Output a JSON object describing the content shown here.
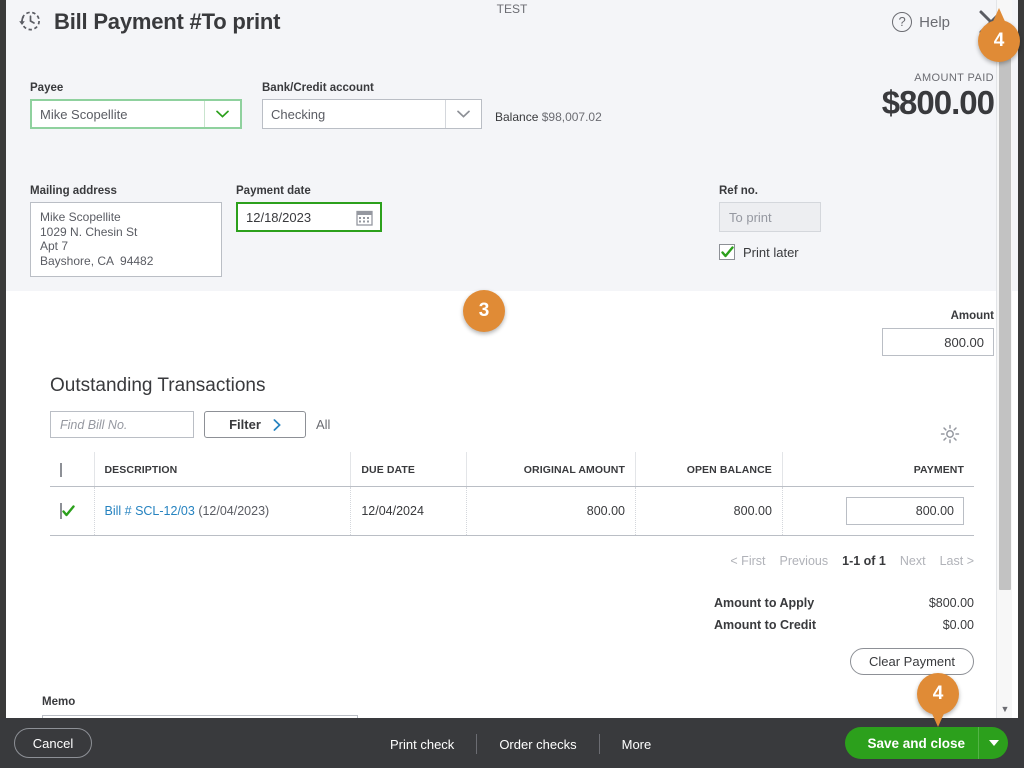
{
  "window": {
    "test_banner": "TEST",
    "title": "Bill Payment #To print",
    "history_icon": "history-clock-icon",
    "help_label": "Help",
    "help_icon": "question-circle-icon",
    "close_icon": "close-x-icon"
  },
  "header": {
    "payee": {
      "label": "Payee",
      "value": "Mike Scopellite",
      "focused": true
    },
    "bank_account": {
      "label": "Bank/Credit account",
      "value": "Checking"
    },
    "balance": {
      "label": "Balance",
      "value": "$98,007.02"
    },
    "amount_paid": {
      "label": "AMOUNT PAID",
      "value": "$800.00"
    },
    "mailing_address": {
      "label": "Mailing address",
      "line1": "Mike Scopellite",
      "line2": "1029 N. Chesin St",
      "line3": "Apt 7",
      "line4": "Bayshore, CA  94482"
    },
    "payment_date": {
      "label": "Payment date",
      "value": "12/18/2023",
      "icon": "calendar-icon"
    },
    "ref_no": {
      "label": "Ref no.",
      "value": "To print"
    },
    "print_later": {
      "label": "Print later",
      "checked": true
    }
  },
  "body": {
    "amount": {
      "label": "Amount",
      "value": "800.00"
    },
    "section_title": "Outstanding Transactions",
    "find_input_placeholder": "Find Bill No.",
    "filter_button": "Filter",
    "all_label": "All",
    "settings_icon": "gear-icon",
    "table": {
      "columns": [
        "",
        "DESCRIPTION",
        "DUE DATE",
        "ORIGINAL AMOUNT",
        "OPEN BALANCE",
        "PAYMENT"
      ],
      "rows": [
        {
          "checked": true,
          "description_link": "Bill # SCL-12/03",
          "description_date": "(12/04/2023)",
          "due_date": "12/04/2024",
          "original_amount": "800.00",
          "open_balance": "800.00",
          "payment": "800.00"
        }
      ]
    },
    "pagination": {
      "first": "< First",
      "previous": "Previous",
      "current": "1-1 of 1",
      "next": "Next",
      "last": "Last >"
    },
    "totals": [
      {
        "label": "Amount to Apply",
        "value": "$800.00"
      },
      {
        "label": "Amount to Credit",
        "value": "$0.00"
      }
    ],
    "clear_payment_button": "Clear Payment",
    "memo": {
      "label": "Memo",
      "value": ""
    }
  },
  "footer": {
    "cancel": "Cancel",
    "print_check": "Print check",
    "order_checks": "Order checks",
    "more": "More",
    "save_and_close": "Save and close",
    "save_caret_icon": "caret-down-icon"
  },
  "callouts": [
    {
      "id": "3",
      "number": "3"
    },
    {
      "id": "4a",
      "number": "4"
    },
    {
      "id": "4b",
      "number": "4"
    }
  ],
  "colors": {
    "accent_green": "#2ca01c",
    "callout_orange": "#e08b36",
    "link_blue": "#2683c0",
    "panel_grey": "#f4f5f8",
    "footer_dark": "#393a3d"
  }
}
